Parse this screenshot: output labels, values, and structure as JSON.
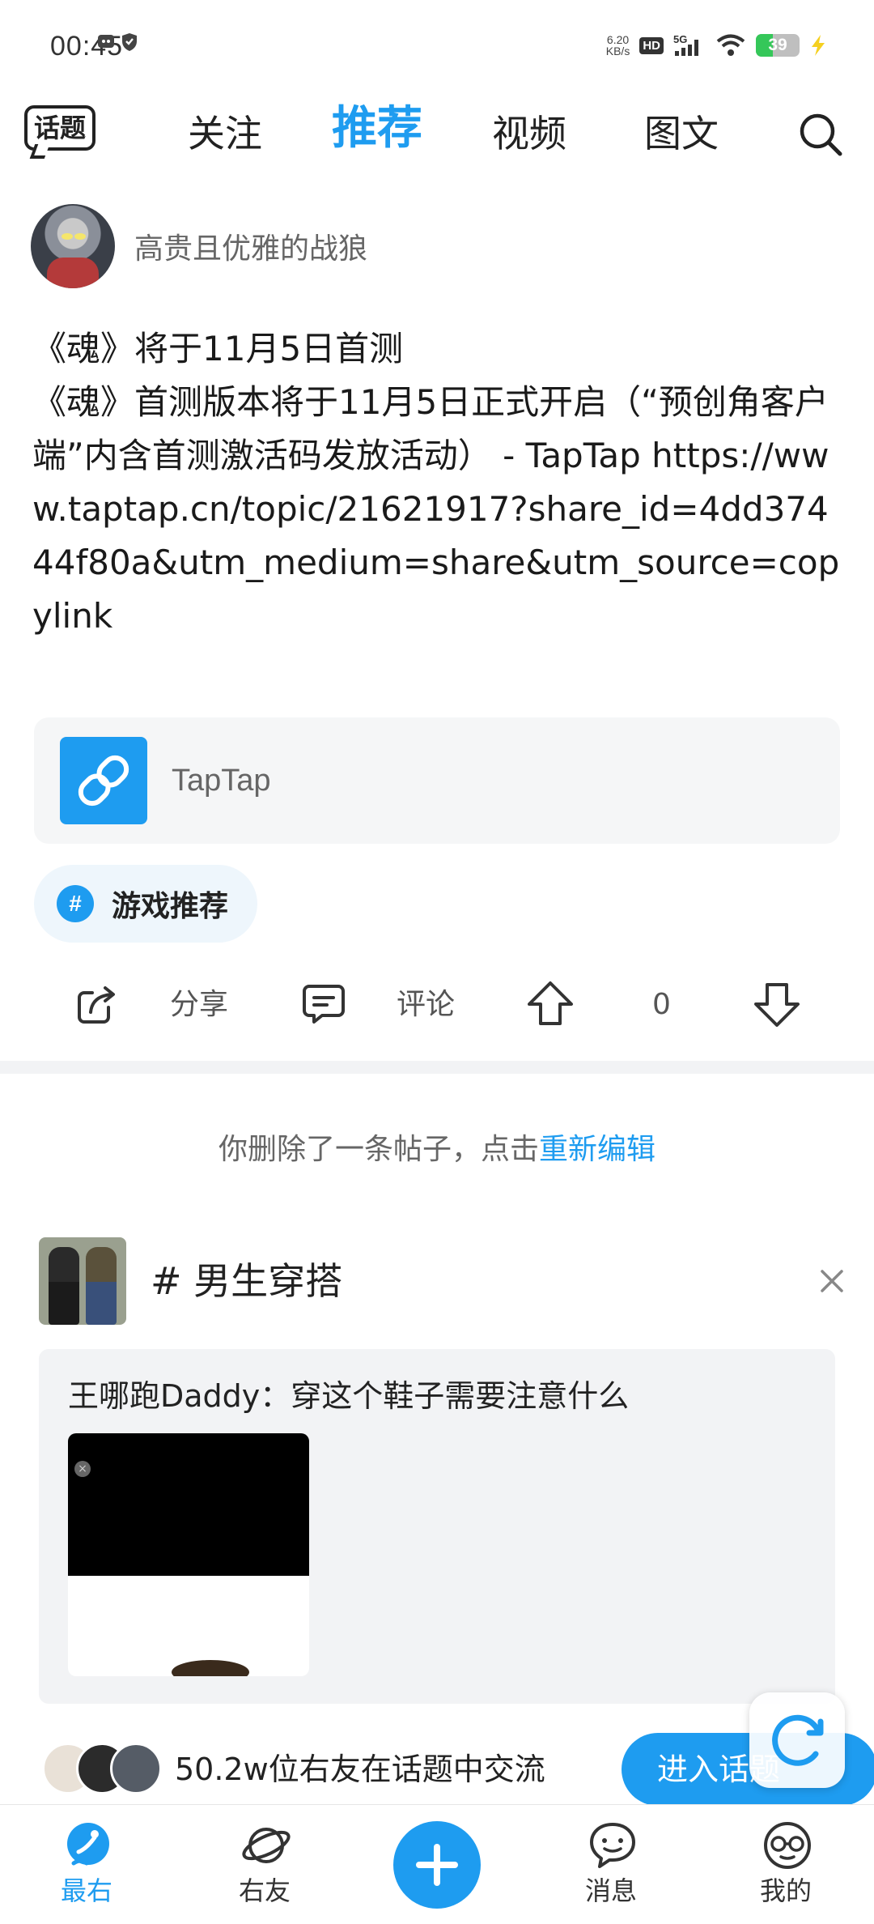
{
  "status_bar": {
    "time": "00:45",
    "net_speed_value": "6.20",
    "net_speed_unit": "KB/s",
    "hd_label": "HD",
    "signal_label": "5G",
    "battery_level": "39",
    "battery_fraction": 0.39
  },
  "top_nav": {
    "topic_label": "话题",
    "tabs": [
      {
        "label": "关注",
        "active": false
      },
      {
        "label": "推荐",
        "active": true
      },
      {
        "label": "视频",
        "active": false
      },
      {
        "label": "图文",
        "active": false
      }
    ],
    "search_icon": "search-icon"
  },
  "post": {
    "author_name": "高贵且优雅的战狼",
    "text": "《魂》将于11月5日首测\n《魂》首测版本将于11月5日正式开启（“预创角客户端”内含首测激活码发放活动） - TapTap https://www.taptap.cn/topic/21621917?share_id=4dd37444f80a&utm_medium=share&utm_source=copylink",
    "link_card_label": "TapTap",
    "tag_label": "游戏推荐",
    "tag_symbol": "#",
    "actions": {
      "share_label": "分享",
      "comment_label": "评论",
      "vote_count": "0"
    }
  },
  "deleted_note": {
    "text": "你删除了一条帖子，点击",
    "link": "重新编辑"
  },
  "topic_block": {
    "title": "# 男生穿搭",
    "card_text": "王哪跑Daddy：穿这个鞋子需要注意什么",
    "community_text": "50.2w位右友在话题中交流",
    "enter_button": "进入话题"
  },
  "bottom_nav": {
    "items": [
      {
        "label": "最右",
        "icon": "home-icon",
        "active": true
      },
      {
        "label": "右友",
        "icon": "planet-icon",
        "active": false
      },
      {
        "label": "消息",
        "icon": "message-icon",
        "active": false
      },
      {
        "label": "我的",
        "icon": "profile-icon",
        "active": false
      }
    ],
    "add_icon": "add-icon"
  },
  "colors": {
    "accent": "#1e9cf0",
    "text_primary": "#1a1a1a",
    "text_secondary": "#666666",
    "card_bg": "#f5f6f7"
  }
}
